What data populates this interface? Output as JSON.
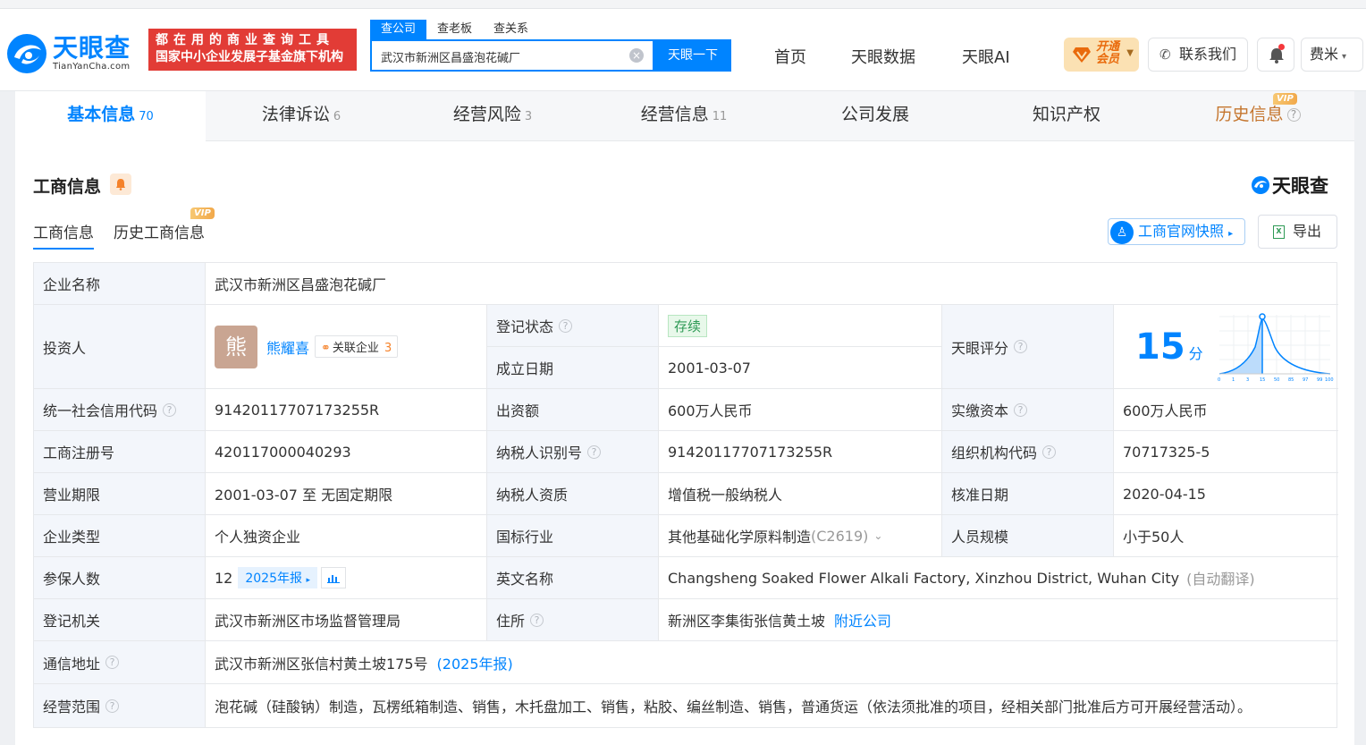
{
  "header": {
    "logo": {
      "name": "天眼查",
      "sub": "TianYanCha.com"
    },
    "slogan": {
      "line1": "都在用的商业查询工具",
      "line2": "国家中小企业发展子基金旗下机构"
    },
    "search": {
      "tabs": [
        "查公司",
        "查老板",
        "查关系"
      ],
      "active_tab": "查公司",
      "value": "武汉市新洲区昌盛泡花碱厂",
      "button": "天眼一下"
    },
    "nav": [
      "首页",
      "天眼数据",
      "天眼AI"
    ],
    "vip_label": "开通会员",
    "contact": "联系我们",
    "user": "费米"
  },
  "tabs": [
    {
      "label": "基本信息",
      "count": "70",
      "active": true
    },
    {
      "label": "法律诉讼",
      "count": "6"
    },
    {
      "label": "经营风险",
      "count": "3"
    },
    {
      "label": "经营信息",
      "count": "11"
    },
    {
      "label": "公司发展",
      "count": ""
    },
    {
      "label": "知识产权",
      "count": ""
    },
    {
      "label": "历史信息",
      "count": "",
      "vip": "VIP"
    }
  ],
  "section": {
    "title": "工商信息",
    "brand": "天眼查",
    "subtabs": [
      "工商信息",
      "历史工商信息"
    ],
    "subtab_vip": "VIP",
    "snapshot_btn": "工商官网快照",
    "export_btn": "导出"
  },
  "info": {
    "company_name_label": "企业名称",
    "company_name": "武汉市新洲区昌盛泡花碱厂",
    "investor_label": "投资人",
    "investor_avatar": "熊",
    "investor_name": "熊耀喜",
    "related_label": "关联企业",
    "related_count": "3",
    "reg_status_label": "登记状态",
    "reg_status": "存续",
    "found_date_label": "成立日期",
    "found_date": "2001-03-07",
    "score_label": "天眼评分",
    "score": "15",
    "score_unit": "分",
    "score_axis": [
      "0",
      "1",
      "3",
      "15",
      "50",
      "85",
      "97",
      "99",
      "100"
    ],
    "credit_code_label": "统一社会信用代码",
    "credit_code": "91420117707173255R",
    "capital_label": "出资额",
    "capital": "600万人民币",
    "paid_capital_label": "实缴资本",
    "paid_capital": "600万人民币",
    "reg_no_label": "工商注册号",
    "reg_no": "420117000040293",
    "taxpayer_id_label": "纳税人识别号",
    "taxpayer_id": "91420117707173255R",
    "org_code_label": "组织机构代码",
    "org_code": "70717325-5",
    "term_label": "营业期限",
    "term": "2001-03-07 至 无固定期限",
    "taxpayer_qual_label": "纳税人资质",
    "taxpayer_qual": "增值税一般纳税人",
    "approve_date_label": "核准日期",
    "approve_date": "2020-04-15",
    "type_label": "企业类型",
    "type": "个人独资企业",
    "industry_label": "国标行业",
    "industry": "其他基础化学原料制造",
    "industry_code": "(C2619)",
    "staff_size_label": "人员规模",
    "staff_size": "小于50人",
    "insured_label": "参保人数",
    "insured": "12",
    "insured_report": "2025年报",
    "en_name_label": "英文名称",
    "en_name": "Changsheng Soaked Flower Alkali Factory, Xinzhou District, Wuhan City",
    "en_name_note": "(自动翻译)",
    "authority_label": "登记机关",
    "authority": "武汉市新洲区市场监督管理局",
    "address_label": "住所",
    "address": "新洲区李集街张信黄土坡",
    "nearby": "附近公司",
    "mail_label": "通信地址",
    "mail": "武汉市新洲区张信村黄土坡175号",
    "mail_report": "(2025年报)",
    "scope_label": "经营范围",
    "scope": "泡花碱（硅酸钠）制造，瓦楞纸箱制造、销售，木托盘加工、销售，粘胶、编丝制造、销售，普通货运（依法须批准的项目，经相关部门批准后方可开展经营活动）。"
  },
  "colors": {
    "brand_blue": "#0084ff",
    "slogan_red": "#e23c36",
    "label_bg": "#f3f6fb",
    "status_green": "#2e9a55"
  }
}
